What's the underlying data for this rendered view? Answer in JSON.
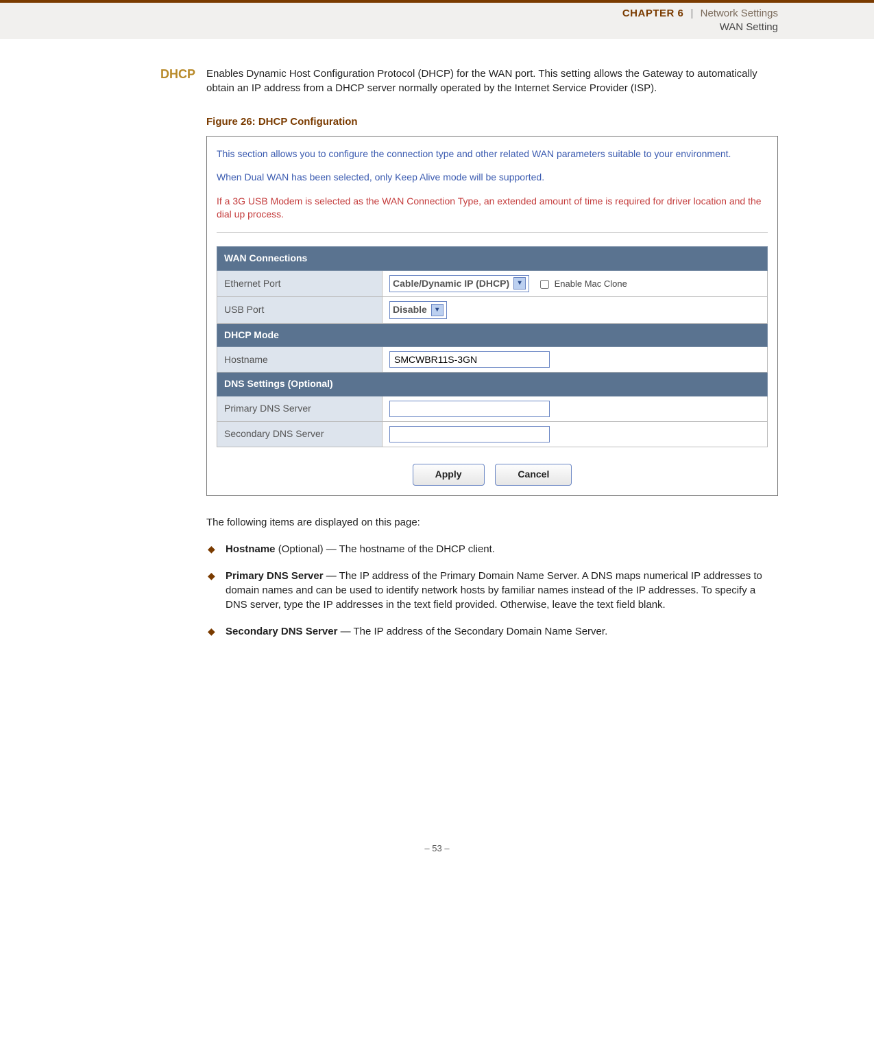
{
  "header": {
    "chapter_small": "C",
    "chapter_rest": "HAPTER 6",
    "divider": "|",
    "title": "Network Settings",
    "subtitle": "WAN Setting"
  },
  "section": {
    "label": "DHCP",
    "intro": "Enables Dynamic Host Configuration Protocol (DHCP) for the WAN port. This setting allows the Gateway to automatically obtain an IP address from a DHCP server normally operated by the Internet Service Provider (ISP).",
    "figure_caption": "Figure 26:  DHCP Configuration"
  },
  "screenshot": {
    "blue1": "This section allows you to configure the connection type and other related WAN parameters suitable to your environment.",
    "blue2": "When Dual WAN has been selected, only Keep Alive mode will be supported.",
    "red": "If a 3G USB Modem is selected as the WAN Connection Type, an extended amount of time is required for driver location and the dial up process.",
    "headers": {
      "wan": "WAN Connections",
      "dhcp": "DHCP Mode",
      "dns": "DNS Settings (Optional)"
    },
    "rows": {
      "eth_label": "Ethernet Port",
      "eth_select": "Cable/Dynamic IP (DHCP)",
      "mac_clone": "Enable Mac Clone",
      "usb_label": "USB Port",
      "usb_select": "Disable",
      "host_label": "Hostname",
      "host_value": "SMCWBR11S-3GN",
      "pdns_label": "Primary DNS Server",
      "pdns_value": "",
      "sdns_label": "Secondary DNS Server",
      "sdns_value": ""
    },
    "buttons": {
      "apply": "Apply",
      "cancel": "Cancel"
    }
  },
  "items_intro": "The following items are displayed on this page:",
  "bullets": {
    "b1_bold": "Hostname",
    "b1_rest": " (Optional) — The hostname of the DHCP client.",
    "b2_bold": "Primary DNS Server",
    "b2_rest": " — The IP address of the Primary Domain Name Server. A DNS maps numerical IP addresses to domain names and can be used to identify network hosts by familiar names instead of the IP addresses. To specify a DNS server, type the IP addresses in the text field provided. Otherwise, leave the text field blank.",
    "b3_bold": "Secondary DNS Server",
    "b3_rest": " — The IP address of the Secondary Domain Name Server."
  },
  "footer": "–  53  –"
}
